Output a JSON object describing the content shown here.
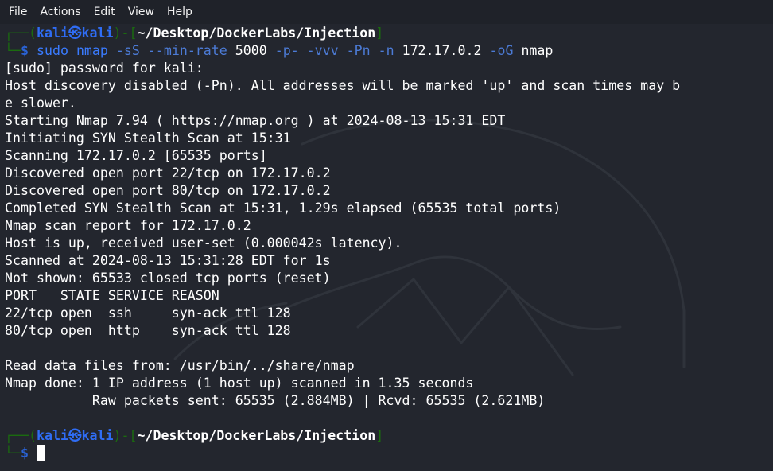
{
  "menubar": {
    "items": [
      "File",
      "Actions",
      "Edit",
      "View",
      "Help"
    ]
  },
  "prompt1": {
    "frame_top": "┌──(",
    "user": "kali",
    "at_symbol": "㉿",
    "host": "kali",
    "frame_mid": ")-[",
    "path": "~/Desktop/DockerLabs/Injection",
    "frame_end": "]",
    "frame_bottom": "└─",
    "dollar": "$",
    "cmd_sudo": "sudo",
    "cmd_rest_1": " nmap ",
    "cmd_flags_1": "-sS --min-rate ",
    "cmd_num": "5000",
    "cmd_flags_2": " -p- -vvv -Pn -n ",
    "cmd_ip": "172.17.0.2",
    "cmd_flags_3": " -oG ",
    "cmd_out": "nmap"
  },
  "output": {
    "lines": [
      "[sudo] password for kali:",
      "Host discovery disabled (-Pn). All addresses will be marked 'up' and scan times may b",
      "e slower.",
      "Starting Nmap 7.94 ( https://nmap.org ) at 2024-08-13 15:31 EDT",
      "Initiating SYN Stealth Scan at 15:31",
      "Scanning 172.17.0.2 [65535 ports]",
      "Discovered open port 22/tcp on 172.17.0.2",
      "Discovered open port 80/tcp on 172.17.0.2",
      "Completed SYN Stealth Scan at 15:31, 1.29s elapsed (65535 total ports)",
      "Nmap scan report for 172.17.0.2",
      "Host is up, received user-set (0.000042s latency).",
      "Scanned at 2024-08-13 15:31:28 EDT for 1s",
      "Not shown: 65533 closed tcp ports (reset)",
      "PORT   STATE SERVICE REASON",
      "22/tcp open  ssh     syn-ack ttl 128",
      "80/tcp open  http    syn-ack ttl 128",
      "",
      "Read data files from: /usr/bin/../share/nmap",
      "Nmap done: 1 IP address (1 host up) scanned in 1.35 seconds",
      "           Raw packets sent: 65535 (2.884MB) | Rcvd: 65535 (2.621MB)",
      ""
    ]
  },
  "prompt2": {
    "frame_top": "┌──(",
    "user": "kali",
    "at_symbol": "㉿",
    "host": "kali",
    "frame_mid": ")-[",
    "path": "~/Desktop/DockerLabs/Injection",
    "frame_end": "]",
    "frame_bottom": "└─",
    "dollar": "$"
  },
  "colors": {
    "background": "#23262e",
    "menubar": "#1f2229",
    "prompt_blue": "#2a63d6",
    "frame_green": "#1b6b0f",
    "text": "#ffffff"
  }
}
